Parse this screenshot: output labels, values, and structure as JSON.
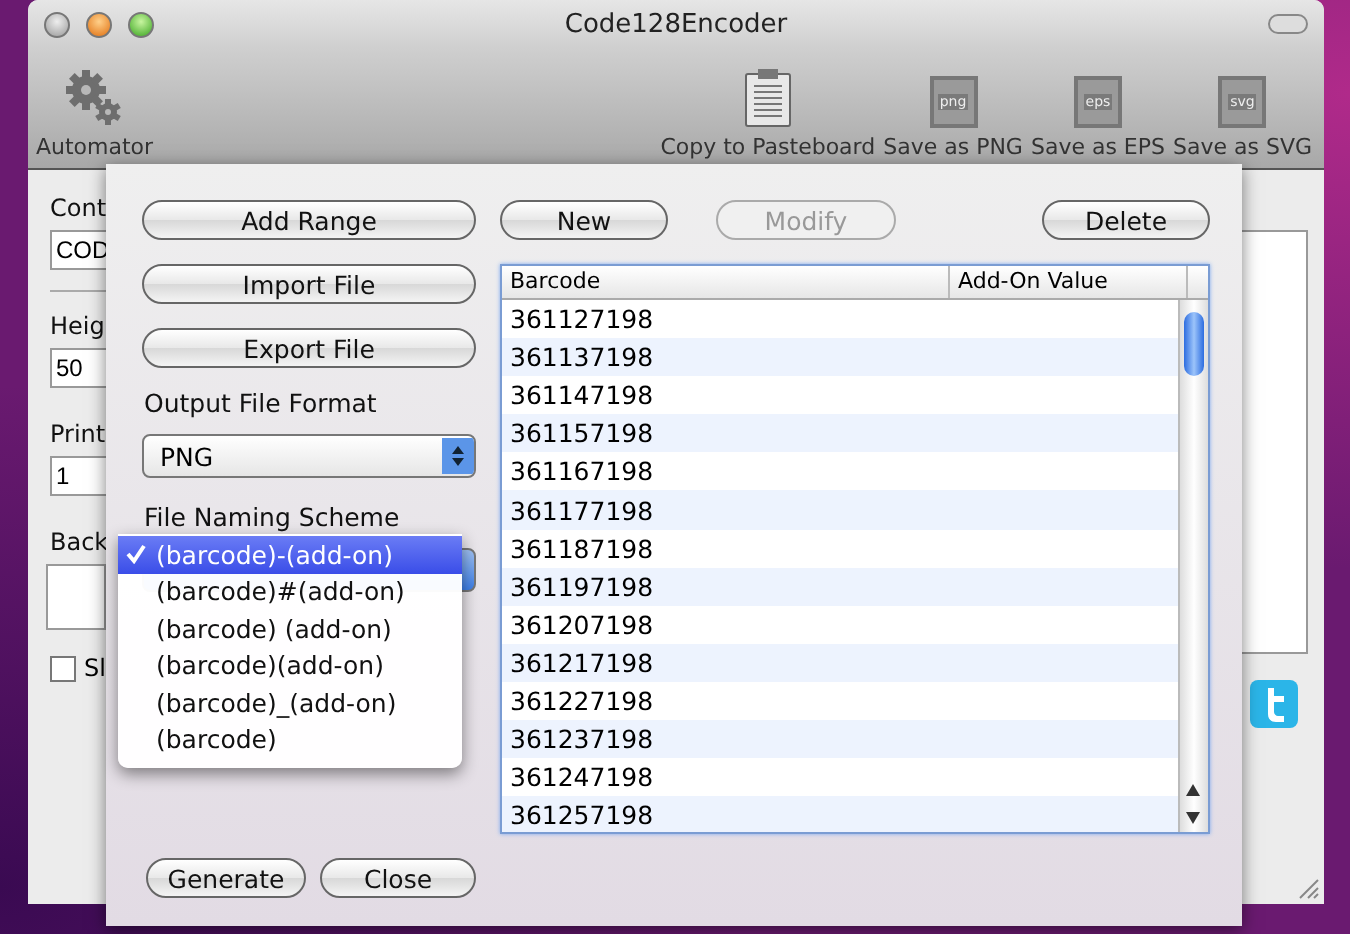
{
  "window": {
    "title": "Code128Encoder"
  },
  "toolbar": [
    {
      "kind": "gear",
      "label": "Automator"
    },
    {
      "kind": "clipboard",
      "label": "Copy to Pasteboard"
    },
    {
      "kind": "file",
      "badge": "png",
      "label": "Save as PNG"
    },
    {
      "kind": "file",
      "badge": "eps",
      "label": "Save as EPS"
    },
    {
      "kind": "file",
      "badge": "svg",
      "label": "Save as SVG"
    }
  ],
  "form": {
    "content_label": "Cont",
    "content_value": "COD",
    "height_label": "Heig",
    "height_value": "50",
    "print_label": "Print",
    "print_value": "1",
    "background_label": "Back",
    "checkbox": {
      "label": "Sl",
      "checked": false
    }
  },
  "sheet": {
    "left_buttons": [
      "Add Range",
      "Import File",
      "Export File"
    ],
    "output_format_label": "Output File Format",
    "output_format": "PNG",
    "naming_label": "File Naming Scheme",
    "naming_menu": [
      {
        "label": "(barcode)-(add-on)",
        "selected": true
      },
      {
        "label": "(barcode)#(add-on)",
        "selected": false
      },
      {
        "label": "(barcode) (add-on)",
        "selected": false
      },
      {
        "label": "(barcode)(add-on)",
        "selected": false
      },
      {
        "label": "(barcode)_(add-on)",
        "selected": false
      },
      {
        "label": "(barcode)",
        "selected": false
      }
    ],
    "top_buttons": [
      {
        "label": "New",
        "disabled": false
      },
      {
        "label": "Modify",
        "disabled": true
      },
      {
        "label": "Delete",
        "disabled": false
      }
    ],
    "table": {
      "columns": [
        "Barcode",
        "Add-On Value"
      ],
      "rows": [
        "361127198",
        "361137198",
        "361147198",
        "361157198",
        "361167198",
        "361177198",
        "361187198",
        "361197198",
        "361207198",
        "361217198",
        "361227198",
        "361237198",
        "361247198",
        "361257198"
      ]
    },
    "bottom_buttons": [
      "Generate",
      "Close"
    ]
  }
}
